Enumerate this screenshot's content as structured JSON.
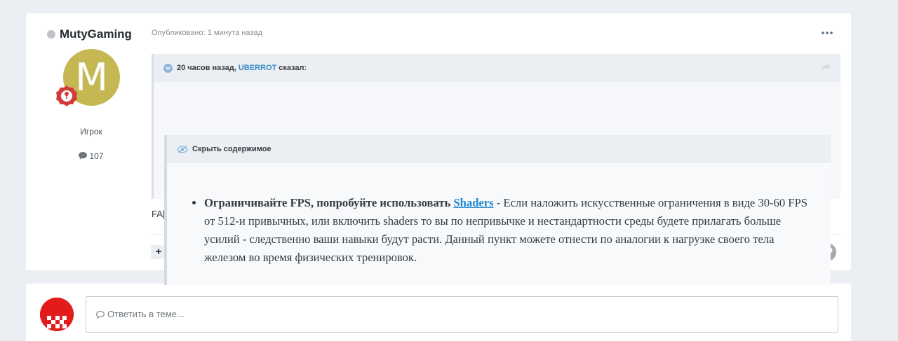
{
  "author": {
    "name": "MutyGaming",
    "avatar_letter": "M",
    "role": "Игрок",
    "post_count": "107",
    "avatar_color": "#c5b853"
  },
  "post": {
    "meta": "Опубликовано: 1 минута назад",
    "text": "FA[",
    "plus_label": "+"
  },
  "quote": {
    "time": "20 часов назад,",
    "user": "UBERROT",
    "said": "сказал:"
  },
  "spoiler": {
    "header": "Скрыть содержимое",
    "bold_text": "Ограничивайте FPS, попробуйте использовать",
    "link_text": "Shaders",
    "rest_text": " - Если наложить искусственные ограничения в виде 30-60 FPS от 512-и привычных, или включить shaders то вы по непривычке и нестандартности среды будете прилагать больше усилий - следственно ваши навыки будут расти. Данный пункт можете отнести по аналогии к нагрузке своего тела железом во время физических тренировок."
  },
  "reply": {
    "placeholder": "Ответить в теме..."
  },
  "colors": {
    "link": "#3a8bc5",
    "background": "#ebeef2",
    "rank_badge": "#d13b3b"
  }
}
